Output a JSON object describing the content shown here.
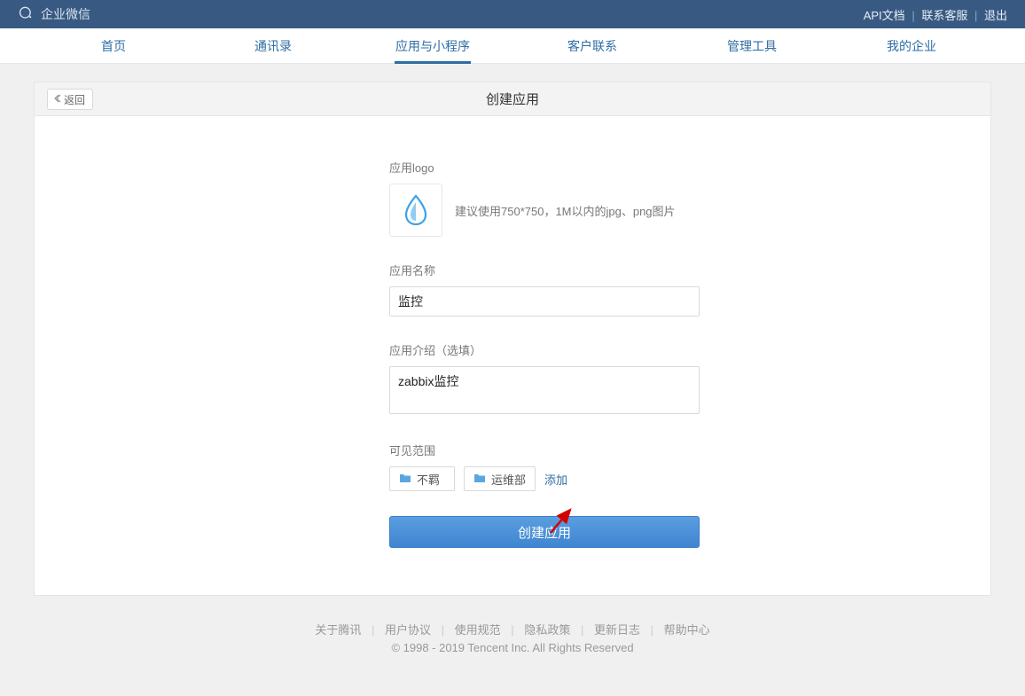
{
  "header": {
    "brand": "企业微信",
    "links": {
      "api_doc": "API文档",
      "contact": "联系客服",
      "logout": "退出"
    }
  },
  "tabs": [
    {
      "id": "home",
      "label": "首页"
    },
    {
      "id": "contacts",
      "label": "通讯录"
    },
    {
      "id": "apps",
      "label": "应用与小程序",
      "active": true
    },
    {
      "id": "customer",
      "label": "客户联系"
    },
    {
      "id": "admin",
      "label": "管理工具"
    },
    {
      "id": "mycompany",
      "label": "我的企业"
    }
  ],
  "page": {
    "back_label": "返回",
    "title": "创建应用"
  },
  "form": {
    "logo": {
      "label": "应用logo",
      "hint": "建议使用750*750，1M以内的jpg、png图片"
    },
    "name": {
      "label": "应用名称",
      "value": "监控"
    },
    "desc": {
      "label": "应用介绍（选填）",
      "value": "zabbix监控"
    },
    "scope": {
      "label": "可见范围",
      "items": [
        "不羁",
        "运维部"
      ],
      "add_label": "添加"
    },
    "submit_label": "创建应用"
  },
  "footer": {
    "links": [
      "关于腾讯",
      "用户协议",
      "使用规范",
      "隐私政策",
      "更新日志",
      "帮助中心"
    ],
    "copyright": "© 1998 - 2019 Tencent Inc. All Rights Reserved"
  }
}
